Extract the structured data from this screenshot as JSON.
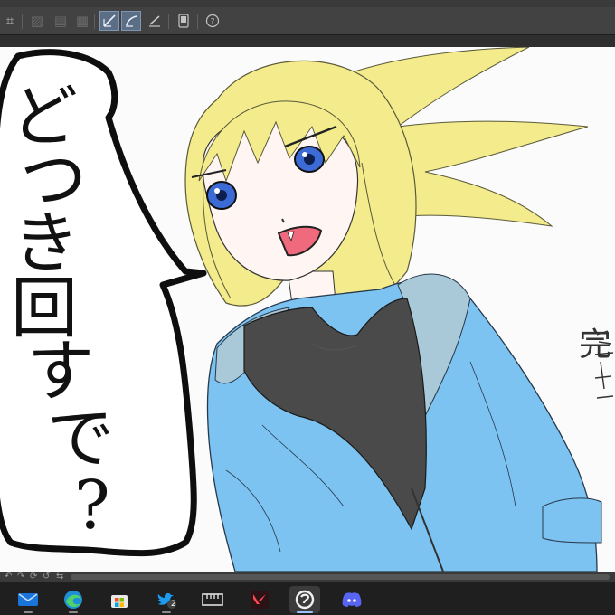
{
  "toolbar": {
    "icons": [
      "crop-icon",
      "hatch-pattern-icon",
      "fill-pattern-icon",
      "grid-icon",
      "pen-check-icon",
      "pen-curve-icon",
      "ruler-pen-icon",
      "phone-icon",
      "help-icon"
    ]
  },
  "bubble": {
    "text_chars": [
      "ど",
      "つ",
      "き",
      "回",
      "す",
      "で",
      "?"
    ]
  },
  "side_text": "完",
  "taskbar": {
    "apps": [
      {
        "name": "mail",
        "badge": ""
      },
      {
        "name": "edge",
        "badge": ""
      },
      {
        "name": "store",
        "badge": ""
      },
      {
        "name": "twitter",
        "badge": "2"
      },
      {
        "name": "ruler-app",
        "badge": ""
      },
      {
        "name": "valorant",
        "badge": ""
      },
      {
        "name": "clip-studio",
        "badge": ""
      },
      {
        "name": "discord",
        "badge": ""
      }
    ]
  },
  "colors": {
    "hair": "#f4ec8c",
    "hoodie": "#7cc3f2",
    "hood_inner": "#a9c9d8",
    "shirt": "#4a4a4a",
    "skin": "#fff6f4",
    "eye": "#3c6bd6",
    "mouth": "#f06a7d",
    "taskbar_bg": "#1f1f1f",
    "toolbar_bg": "#424242"
  }
}
